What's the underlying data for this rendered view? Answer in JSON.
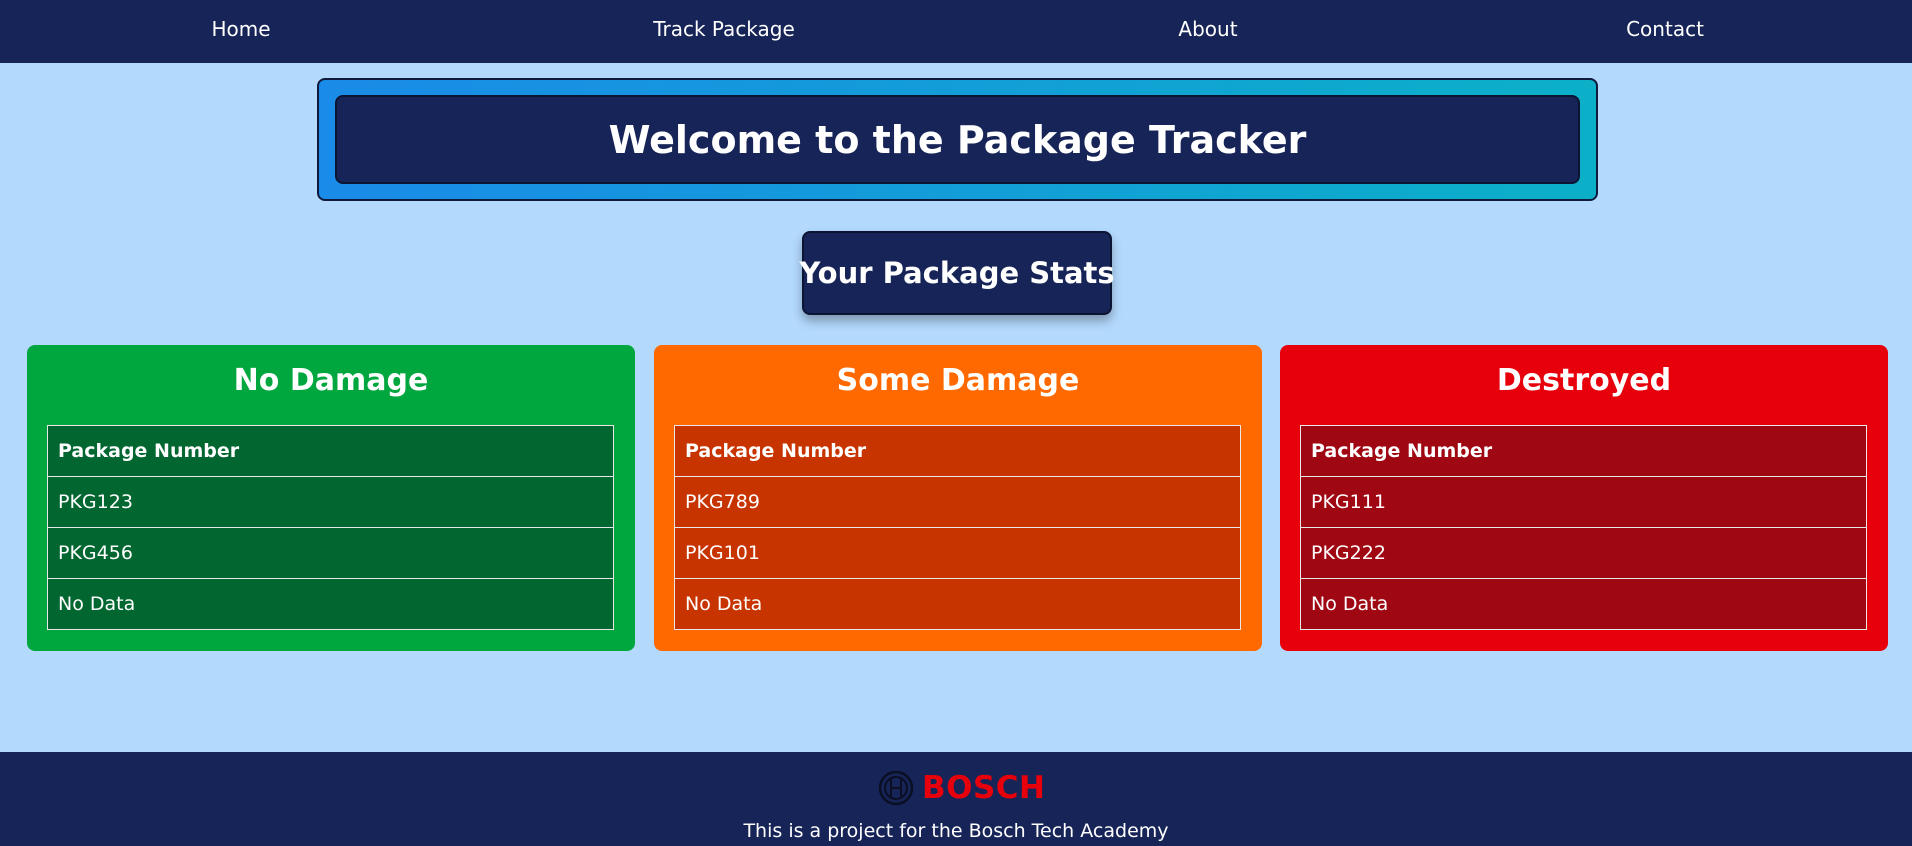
{
  "nav": {
    "items": [
      {
        "label": "Home"
      },
      {
        "label": "Track Package"
      },
      {
        "label": "About"
      },
      {
        "label": "Contact"
      }
    ]
  },
  "banner": {
    "title": "Welcome to the Package Tracker"
  },
  "stats": {
    "heading": "Your Package Stats"
  },
  "cards": [
    {
      "title": "No Damage",
      "color": "#00a63e",
      "table_color": "#016630",
      "header": "Package Number",
      "rows": [
        "PKG123",
        "PKG456",
        "No Data"
      ]
    },
    {
      "title": "Some Damage",
      "color": "#ff6900",
      "table_color": "#c83400",
      "header": "Package Number",
      "rows": [
        "PKG789",
        "PKG101",
        "No Data"
      ]
    },
    {
      "title": "Destroyed",
      "color": "#e7000b",
      "table_color": "#9f0712",
      "header": "Package Number",
      "rows": [
        "PKG111",
        "PKG222",
        "No Data"
      ]
    }
  ],
  "footer": {
    "brand": "BOSCH",
    "brand_color": "#e7000b",
    "text": "This is a project for the Bosch Tech Academy",
    "logo_icon": "bosch-armature-icon"
  },
  "colors": {
    "nav_bg": "#172457",
    "page_bg": "#b3d9fd"
  }
}
